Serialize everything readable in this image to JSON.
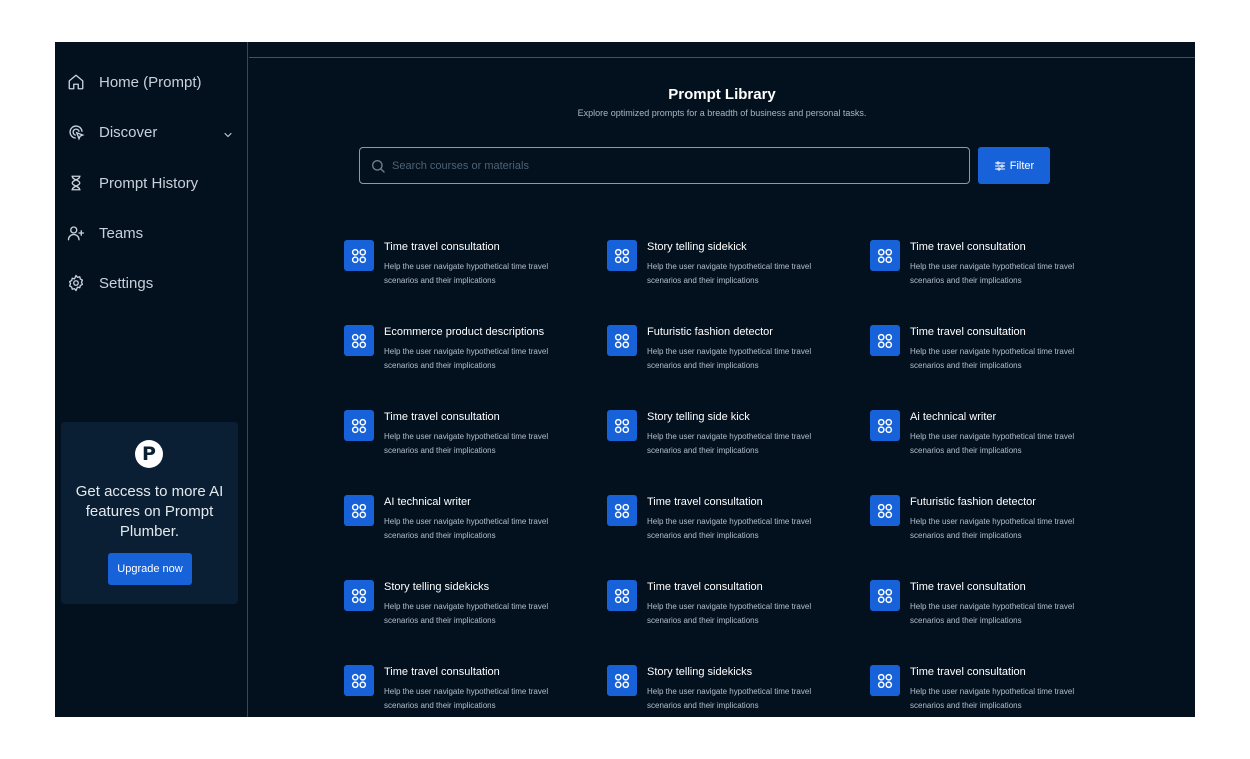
{
  "sidebar": {
    "items": [
      {
        "label": "Home (Prompt)",
        "icon": "home-icon"
      },
      {
        "label": "Discover",
        "icon": "discover-icon"
      },
      {
        "label": "Prompt History",
        "icon": "hourglass-icon"
      },
      {
        "label": "Teams",
        "icon": "add-user-icon"
      },
      {
        "label": "Settings",
        "icon": "gear-icon"
      }
    ],
    "upgrade": {
      "logo_text": "P",
      "text": "Get access to more AI features on Prompt Plumber.",
      "button_label": "Upgrade now"
    }
  },
  "main": {
    "title": "Prompt Library",
    "subtitle": "Explore optimized prompts for a breadth of business and personal tasks.",
    "search": {
      "placeholder": "Search courses or materials",
      "value": ""
    },
    "filter_label": "Filter",
    "prompts": [
      {
        "title": "Time travel consultation",
        "description": "Help the user navigate hypothetical time travel scenarios and their implications"
      },
      {
        "title": "Story telling sidekick",
        "description": "Help the user navigate hypothetical time travel scenarios and their implications"
      },
      {
        "title": "Time travel consultation",
        "description": "Help the user navigate hypothetical time travel scenarios and their implications"
      },
      {
        "title": "Ecommerce product descriptions",
        "description": "Help the user navigate hypothetical time travel scenarios and their implications"
      },
      {
        "title": "Futuristic fashion detector",
        "description": "Help the user navigate hypothetical time travel scenarios and their implications"
      },
      {
        "title": "Time travel consultation",
        "description": "Help the user navigate hypothetical time travel scenarios and their implications"
      },
      {
        "title": "Time travel consultation",
        "description": "Help the user navigate hypothetical time travel scenarios and their implications"
      },
      {
        "title": "Story telling side kick",
        "description": "Help the user navigate hypothetical time travel scenarios and their implications"
      },
      {
        "title": "Ai technical writer",
        "description": "Help the user navigate hypothetical time travel scenarios and their implications"
      },
      {
        "title": "AI technical writer",
        "description": "Help the user navigate hypothetical time travel scenarios and their implications"
      },
      {
        "title": "Time travel consultation",
        "description": "Help the user navigate hypothetical time travel scenarios and their implications"
      },
      {
        "title": "Futuristic fashion detector",
        "description": "Help the user navigate hypothetical time travel scenarios and their implications"
      },
      {
        "title": "Story telling sidekicks",
        "description": "Help the user navigate hypothetical time travel scenarios and their implications"
      },
      {
        "title": "Time travel consultation",
        "description": "Help the user navigate hypothetical time travel scenarios and their implications"
      },
      {
        "title": "Time travel consultation",
        "description": "Help the user navigate hypothetical time travel scenarios and their implications"
      },
      {
        "title": "Time travel consultation",
        "description": "Help the user navigate hypothetical time travel scenarios and their implications"
      },
      {
        "title": "Story telling sidekicks",
        "description": "Help the user navigate hypothetical time travel scenarios and their implications"
      },
      {
        "title": "Time travel consultation",
        "description": "Help the user navigate hypothetical time travel scenarios and their implications"
      }
    ],
    "card_icon": "apps-grid-icon"
  },
  "colors": {
    "background": "#03111f",
    "accent": "#1762d9",
    "card_bg": "#0a1f33"
  }
}
